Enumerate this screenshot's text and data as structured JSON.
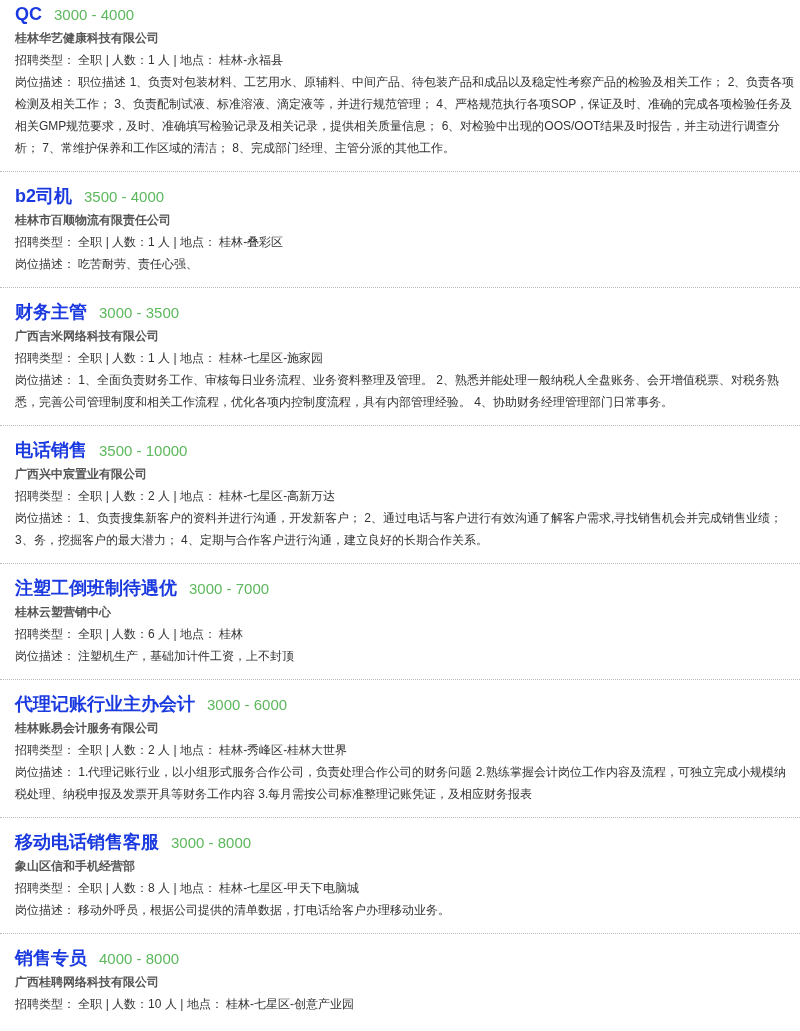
{
  "jobs": [
    {
      "title": "QC",
      "salary": "3000 - 4000",
      "company": "桂林华艺健康科技有限公司",
      "meta": "招聘类型： 全职 | 人数：1 人 | 地点： 桂林-永福县",
      "description": "岗位描述： 职位描述 1、负责对包装材料、工艺用水、原辅料、中间产品、待包装产品和成品以及稳定性考察产品的检验及相关工作； 2、负责各项检测及相关工作； 3、负责配制试液、标准溶液、滴定液等，并进行规范管理； 4、严格规范执行各项SOP，保证及时、准确的完成各项检验任务及相关GMP规范要求，及时、准确填写检验记录及相关记录，提供相关质量信息； 6、对检验中出现的OOS/OOT结果及时报告，并主动进行调查分析； 7、常维护保养和工作区域的清洁； 8、完成部门经理、主管分派的其他工作。"
    },
    {
      "title": "b2司机",
      "salary": "3500 - 4000",
      "company": "桂林市百顺物流有限责任公司",
      "meta": "招聘类型： 全职 | 人数：1 人 | 地点： 桂林-叠彩区",
      "description": "岗位描述： 吃苦耐劳、责任心强、"
    },
    {
      "title": "财务主管",
      "salary": "3000 - 3500",
      "company": "广西吉米网络科技有限公司",
      "meta": "招聘类型： 全职 | 人数：1 人 | 地点： 桂林-七星区-施家园",
      "description": "岗位描述： 1、全面负责财务工作、审核每日业务流程、业务资料整理及管理。 2、熟悉并能处理一般纳税人全盘账务、会开增值税票、对税务熟悉，完善公司管理制度和相关工作流程，优化各项内控制度流程，具有内部管理经验。 4、协助财务经理管理部门日常事务。"
    },
    {
      "title": "电话销售",
      "salary": "3500 - 10000",
      "company": "广西兴中宸置业有限公司",
      "meta": "招聘类型： 全职 | 人数：2 人 | 地点： 桂林-七星区-高新万达",
      "description": "岗位描述： 1、负责搜集新客户的资料并进行沟通，开发新客户； 2、通过电话与客户进行有效沟通了解客户需求,寻找销售机会并完成销售业绩； 3、务，挖掘客户的最大潜力； 4、定期与合作客户进行沟通，建立良好的长期合作关系。"
    },
    {
      "title": "注塑工倒班制待遇优",
      "salary": "3000 - 7000",
      "company": "桂林云塑营销中心",
      "meta": "招聘类型： 全职 | 人数：6 人 | 地点： 桂林",
      "description": "岗位描述： 注塑机生产，基础加计件工资，上不封顶"
    },
    {
      "title": "代理记账行业主办会计",
      "salary": "3000 - 6000",
      "company": "桂林账易会计服务有限公司",
      "meta": "招聘类型： 全职 | 人数：2 人 | 地点： 桂林-秀峰区-桂林大世界",
      "description": "岗位描述： 1.代理记账行业，以小组形式服务合作公司，负责处理合作公司的财务问题 2.熟练掌握会计岗位工作内容及流程，可独立完成小规模纳税处理、纳税申报及发票开具等财务工作内容 3.每月需按公司标准整理记账凭证，及相应财务报表"
    },
    {
      "title": "移动电话销售客服",
      "salary": "3000 - 8000",
      "company": "象山区信和手机经营部",
      "meta": "招聘类型： 全职 | 人数：8 人 | 地点： 桂林-七星区-甲天下电脑城",
      "description": "岗位描述： 移动外呼员，根据公司提供的清单数据，打电话给客户办理移动业务。"
    },
    {
      "title": "销售专员",
      "salary": "4000 - 8000",
      "company": "广西桂聘网络科技有限公司",
      "meta": "招聘类型： 全职 | 人数：10 人 | 地点： 桂林-七星区-创意产业园"
    }
  ]
}
